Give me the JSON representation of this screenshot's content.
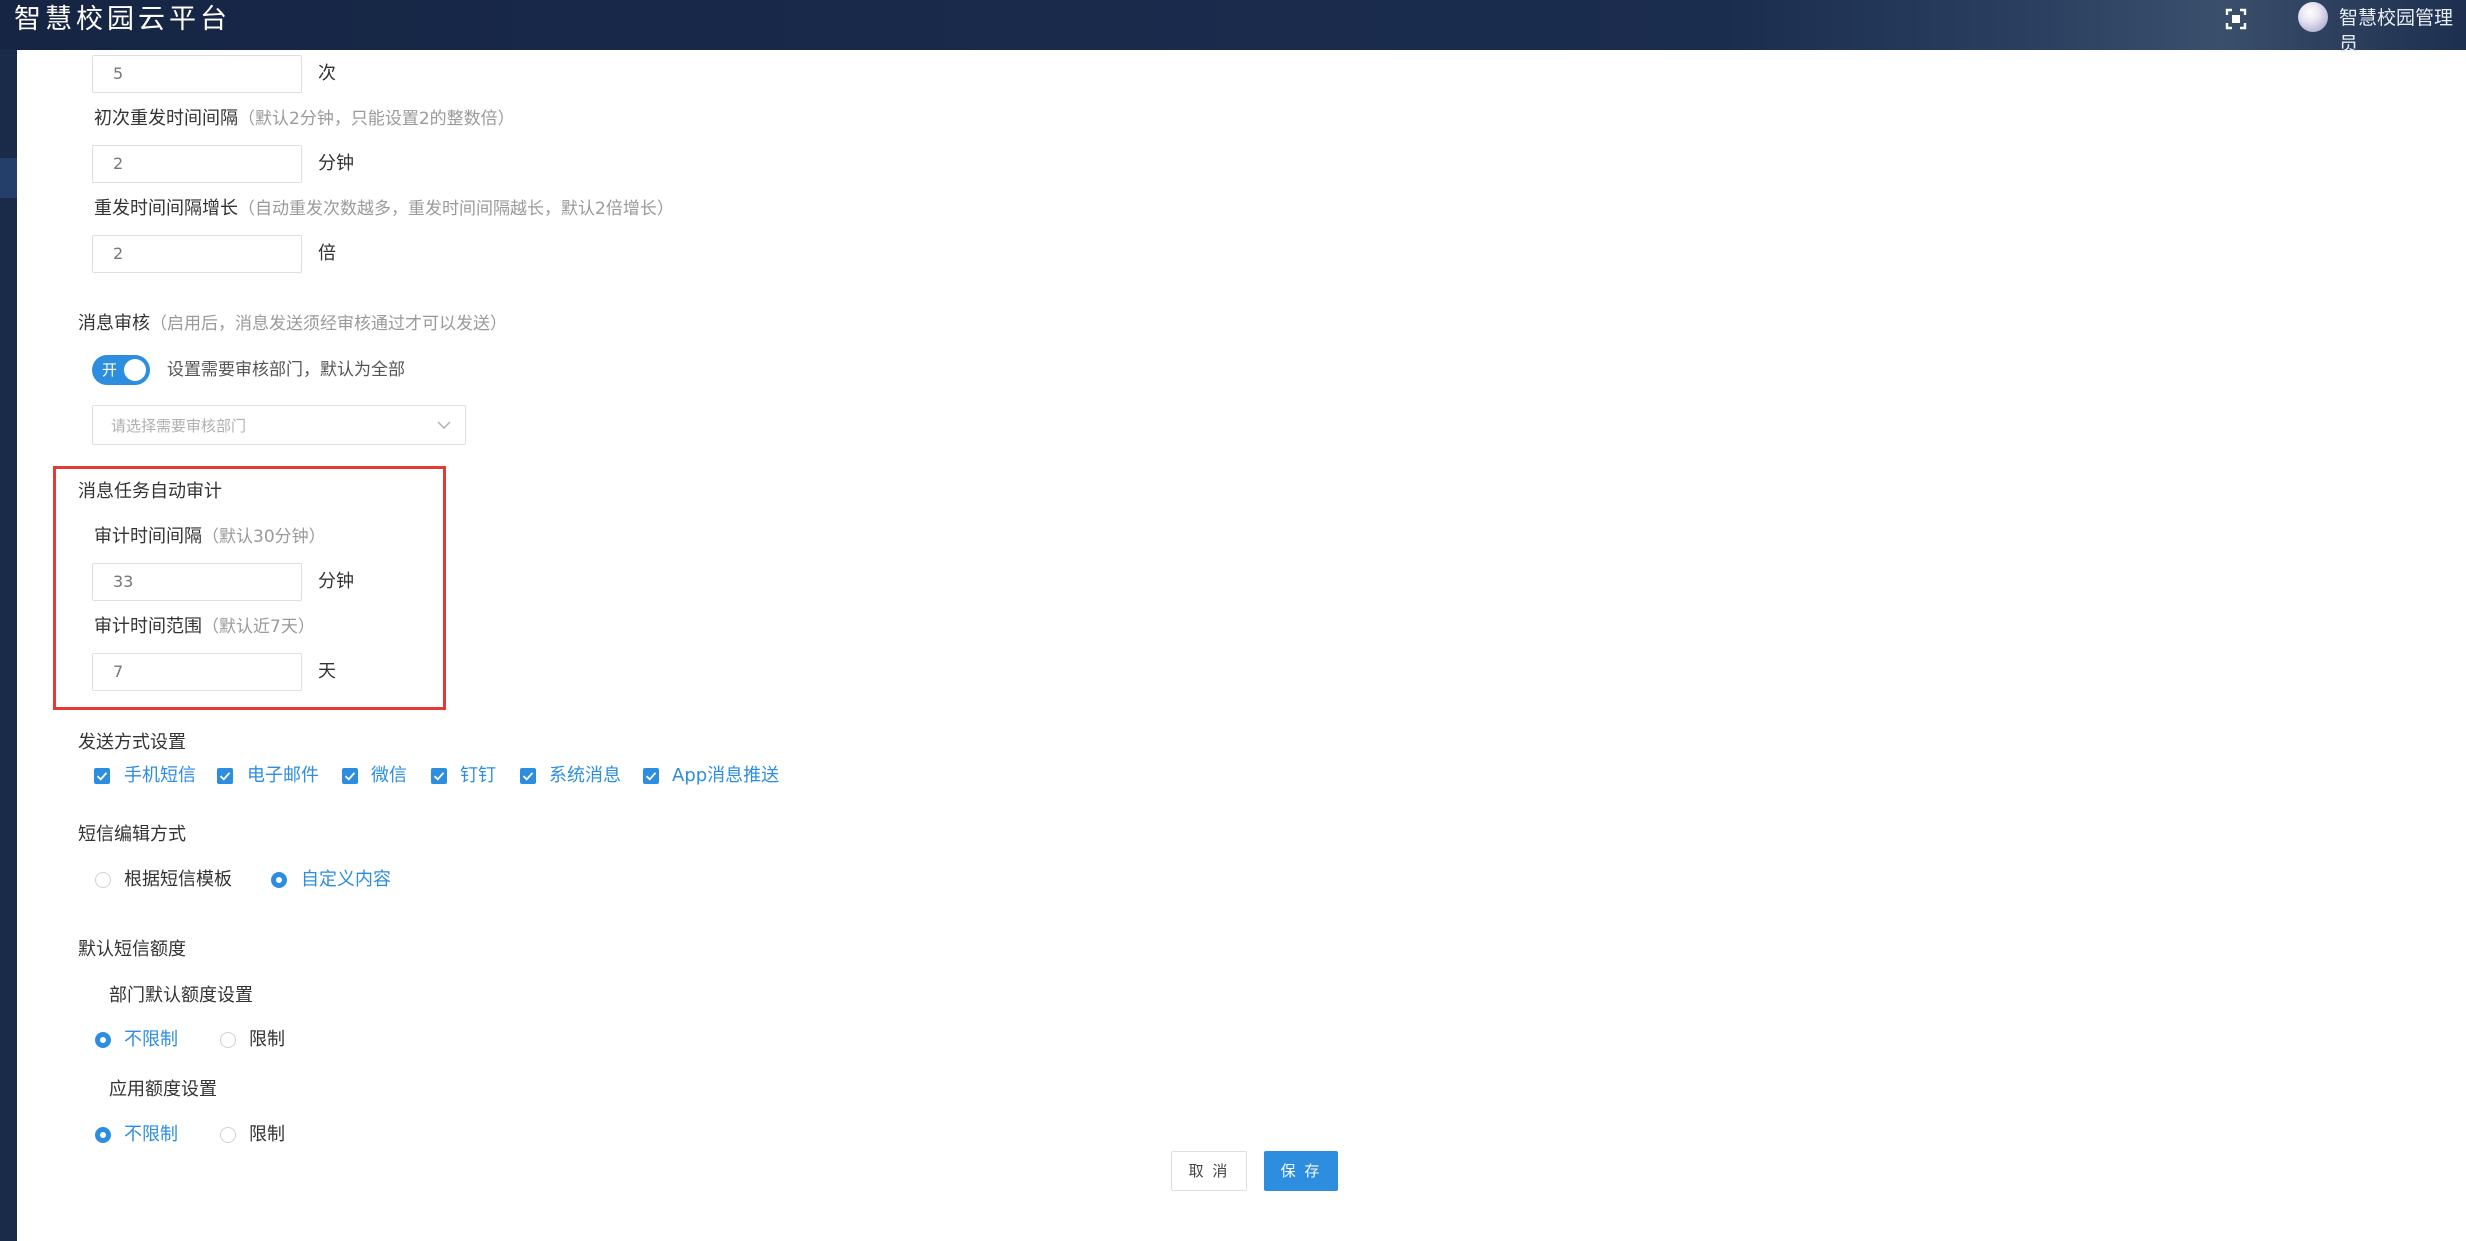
{
  "header": {
    "app_title": "智慧校园云平台",
    "user_name": "智慧校园管理员",
    "icons": [
      "fullscreen-icon",
      "avatar"
    ]
  },
  "resend": {
    "count_value": "5",
    "count_unit": "次",
    "initial_interval_label": "初次重发时间间隔",
    "initial_interval_hint": "（默认2分钟，只能设置2的整数倍）",
    "initial_interval_value": "2",
    "initial_interval_unit": "分钟",
    "growth_label": "重发时间间隔增长",
    "growth_hint": "（自动重发次数越多，重发时间间隔越长，默认2倍增长）",
    "growth_value": "2",
    "growth_unit": "倍"
  },
  "review": {
    "title": "消息审核",
    "hint": "（启用后，消息发送须经审核通过才可以发送）",
    "toggle_label": "开",
    "toggle_on": true,
    "toggle_desc": "设置需要审核部门，默认为全部",
    "dept_placeholder": "请选择需要审核部门"
  },
  "audit": {
    "title": "消息任务自动审计",
    "interval_label": "审计时间间隔",
    "interval_hint": "（默认30分钟）",
    "interval_value": "33",
    "interval_unit": "分钟",
    "range_label": "审计时间范围",
    "range_hint": "（默认近7天）",
    "range_value": "7",
    "range_unit": "天",
    "highlight_color": "#e53935"
  },
  "send_methods": {
    "title": "发送方式设置",
    "options": [
      {
        "label": "手机短信",
        "checked": true
      },
      {
        "label": "电子邮件",
        "checked": true
      },
      {
        "label": "微信",
        "checked": true
      },
      {
        "label": "钉钉",
        "checked": true
      },
      {
        "label": "系统消息",
        "checked": true
      },
      {
        "label": "App消息推送",
        "checked": true
      }
    ]
  },
  "sms_edit": {
    "title": "短信编辑方式",
    "options": [
      {
        "label": "根据短信模板",
        "selected": false
      },
      {
        "label": "自定义内容",
        "selected": true
      }
    ]
  },
  "quota": {
    "title": "默认短信额度",
    "dept_title": "部门默认额度设置",
    "dept_options": [
      {
        "label": "不限制",
        "selected": true
      },
      {
        "label": "限制",
        "selected": false
      }
    ],
    "app_title": "应用额度设置",
    "app_options": [
      {
        "label": "不限制",
        "selected": true
      },
      {
        "label": "限制",
        "selected": false
      }
    ]
  },
  "actions": {
    "cancel_label": "取 消",
    "save_label": "保 存"
  },
  "colors": {
    "accent": "#2d8ee0",
    "header_bg": "#1b2d4f",
    "highlight": "#e53935"
  }
}
